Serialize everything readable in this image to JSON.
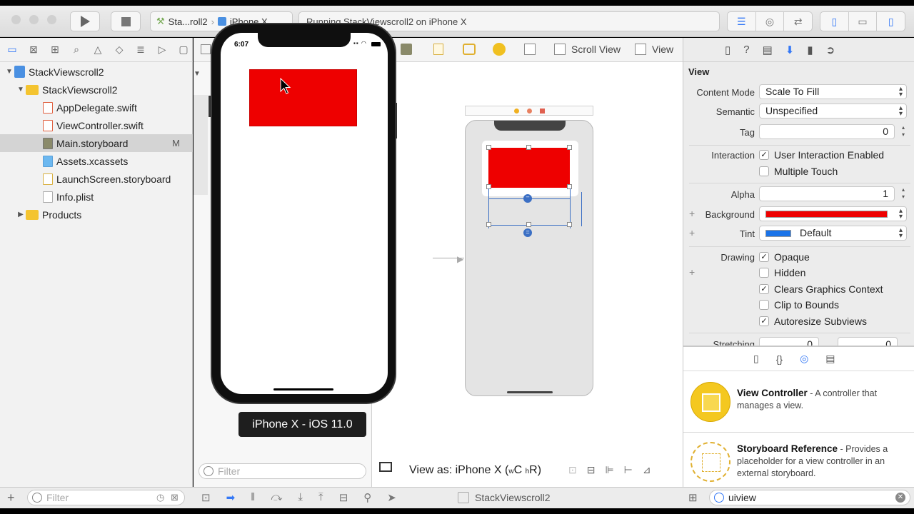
{
  "toolbar": {
    "scheme_project": "Sta...roll2",
    "scheme_device": "iPhone X",
    "activity_status": "Running StackViewscroll2 on iPhone X"
  },
  "navigator": {
    "items": [
      {
        "label": "StackViewscroll2",
        "type": "project"
      },
      {
        "label": "StackViewscroll2",
        "type": "folder"
      },
      {
        "label": "AppDelegate.swift",
        "type": "swift"
      },
      {
        "label": "ViewController.swift",
        "type": "swift"
      },
      {
        "label": "Main.storyboard",
        "type": "storyboard",
        "badge": "M",
        "selected": true
      },
      {
        "label": "Assets.xcassets",
        "type": "assets"
      },
      {
        "label": "LaunchScreen.storyboard",
        "type": "storyboard"
      },
      {
        "label": "Info.plist",
        "type": "plist"
      },
      {
        "label": "Products",
        "type": "folder"
      }
    ],
    "filter_placeholder": "Filter"
  },
  "outline": {
    "filter_placeholder": "Filter"
  },
  "jumpbar": {
    "crumbs": [
      "Scroll View",
      "View"
    ]
  },
  "canvas": {
    "view_as": "View as: iPhone X (",
    "view_as_w": "w",
    "view_as_c": "C",
    "view_as_h": "h",
    "view_as_r": "R)",
    "colors": {
      "red_view": "#ee0000"
    }
  },
  "simulator": {
    "time": "6:07",
    "label": "iPhone X - iOS 11.0"
  },
  "inspector": {
    "section_title": "View",
    "content_mode_label": "Content Mode",
    "content_mode_value": "Scale To Fill",
    "semantic_label": "Semantic",
    "semantic_value": "Unspecified",
    "tag_label": "Tag",
    "tag_value": "0",
    "interaction_label": "Interaction",
    "user_interaction": "User Interaction Enabled",
    "multiple_touch": "Multiple Touch",
    "alpha_label": "Alpha",
    "alpha_value": "1",
    "background_label": "Background",
    "background_color": "#ee0000",
    "tint_label": "Tint",
    "tint_value": "Default",
    "tint_color": "#1a73e8",
    "drawing_label": "Drawing",
    "opaque": "Opaque",
    "hidden": "Hidden",
    "clears_graphics": "Clears Graphics Context",
    "clip_to_bounds": "Clip to Bounds",
    "autoresize": "Autoresize Subviews",
    "stretching_label": "Stretching",
    "stretch_x": "0",
    "stretch_y": "0"
  },
  "library": {
    "items": [
      {
        "title": "View Controller",
        "desc": " - A controller that manages a view."
      },
      {
        "title": "Storyboard Reference",
        "desc": " - Provides a placeholder for a view controller in an external storyboard."
      }
    ],
    "search_value": "uiview"
  },
  "bottombar": {
    "scheme_name": "StackViewscroll2"
  }
}
